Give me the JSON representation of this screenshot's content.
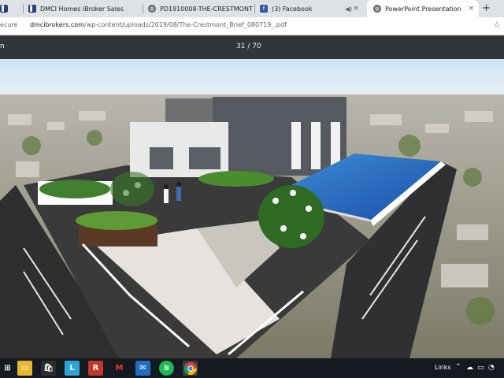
{
  "browser": {
    "tabs": [
      {
        "label": "",
        "icon": "dmci-icon"
      },
      {
        "label": "DMCI Homes iBroker Sales",
        "icon": "dmci-icon"
      },
      {
        "label": "PD1910008-THE-CRESTMONT",
        "icon": "globe-icon"
      },
      {
        "label": "(3) Facebook",
        "icon": "facebook-icon"
      },
      {
        "label": "PowerPoint Presentation",
        "icon": "globe-icon",
        "active": true
      }
    ],
    "tab_close": "×",
    "new_tab": "+",
    "address": {
      "security": "ecure",
      "domain": "dmcibrokers.com",
      "path": "/wp-content/uploads/2019/08/The-Crestmont_Brief_080719_.pdf"
    }
  },
  "pdf": {
    "title": "n",
    "page_indicator": "31 / 70",
    "render_alt": "Rooftop amenity deck with infinity pool overlooking the city"
  },
  "taskbar": {
    "apps": [
      "windows-start",
      "explorer",
      "store",
      "lexicon",
      "roboform",
      "mcafee",
      "mail",
      "spotify",
      "chrome"
    ],
    "links_label": "Links",
    "colors": {
      "bg": "#151a20",
      "accent": "#0f9d58"
    }
  }
}
